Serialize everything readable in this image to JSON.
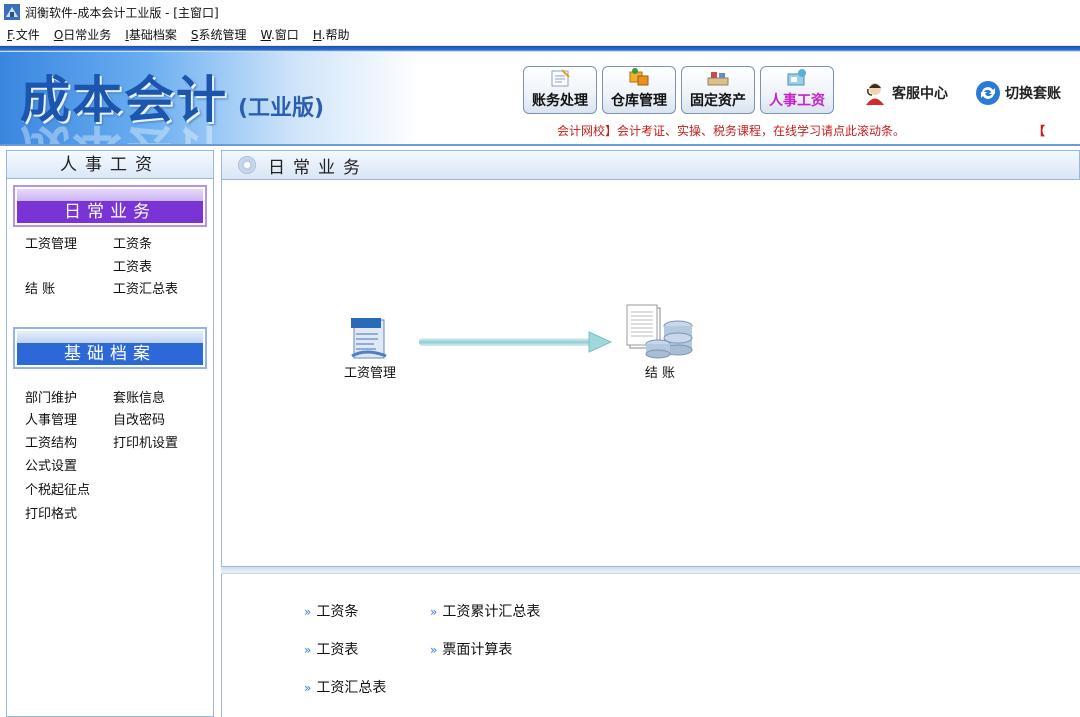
{
  "window": {
    "title": "润衡软件-成本会计工业版 - [主窗口]"
  },
  "menu": [
    {
      "key": "F",
      "label": ".文件"
    },
    {
      "key": "O",
      "label": "日常业务"
    },
    {
      "key": "I",
      "label": "基础档案"
    },
    {
      "key": "S",
      "label": "系统管理"
    },
    {
      "key": "W",
      "label": ".窗口"
    },
    {
      "key": "H",
      "label": ".帮助"
    }
  ],
  "header": {
    "brand": "成本会计",
    "edition": "(工业版)",
    "modules": [
      "账务处理",
      "仓库管理",
      "固定资产",
      "人事工资"
    ],
    "service": "客服中心",
    "switch": "切换套账",
    "ticker": "会计网校】会计考证、实操、税务课程，在线学习请点此滚动条。",
    "ticker_end": "【"
  },
  "left": {
    "title": "人事工资",
    "sections": [
      {
        "title": "日常业务",
        "links": [
          "工资管理",
          "工资条",
          "工资表",
          "结 账",
          "工资汇总表"
        ]
      },
      {
        "title": "基础档案",
        "links": [
          "部门维护",
          "套账信息",
          "人事管理",
          "自改密码",
          "工资结构",
          "打印机设置",
          "公式设置",
          "个税起征点",
          "打印格式"
        ]
      }
    ]
  },
  "main": {
    "title": "日常业务",
    "flow": [
      "工资管理",
      "结 账"
    ],
    "reports": [
      "工资条",
      "工资累计汇总表",
      "工资表",
      "票面计算表",
      "工资汇总表"
    ]
  },
  "colors": {
    "accent": "#2c68d6",
    "purple": "#7a34d6",
    "ticker": "#c42020",
    "active_module": "#c424c8"
  }
}
